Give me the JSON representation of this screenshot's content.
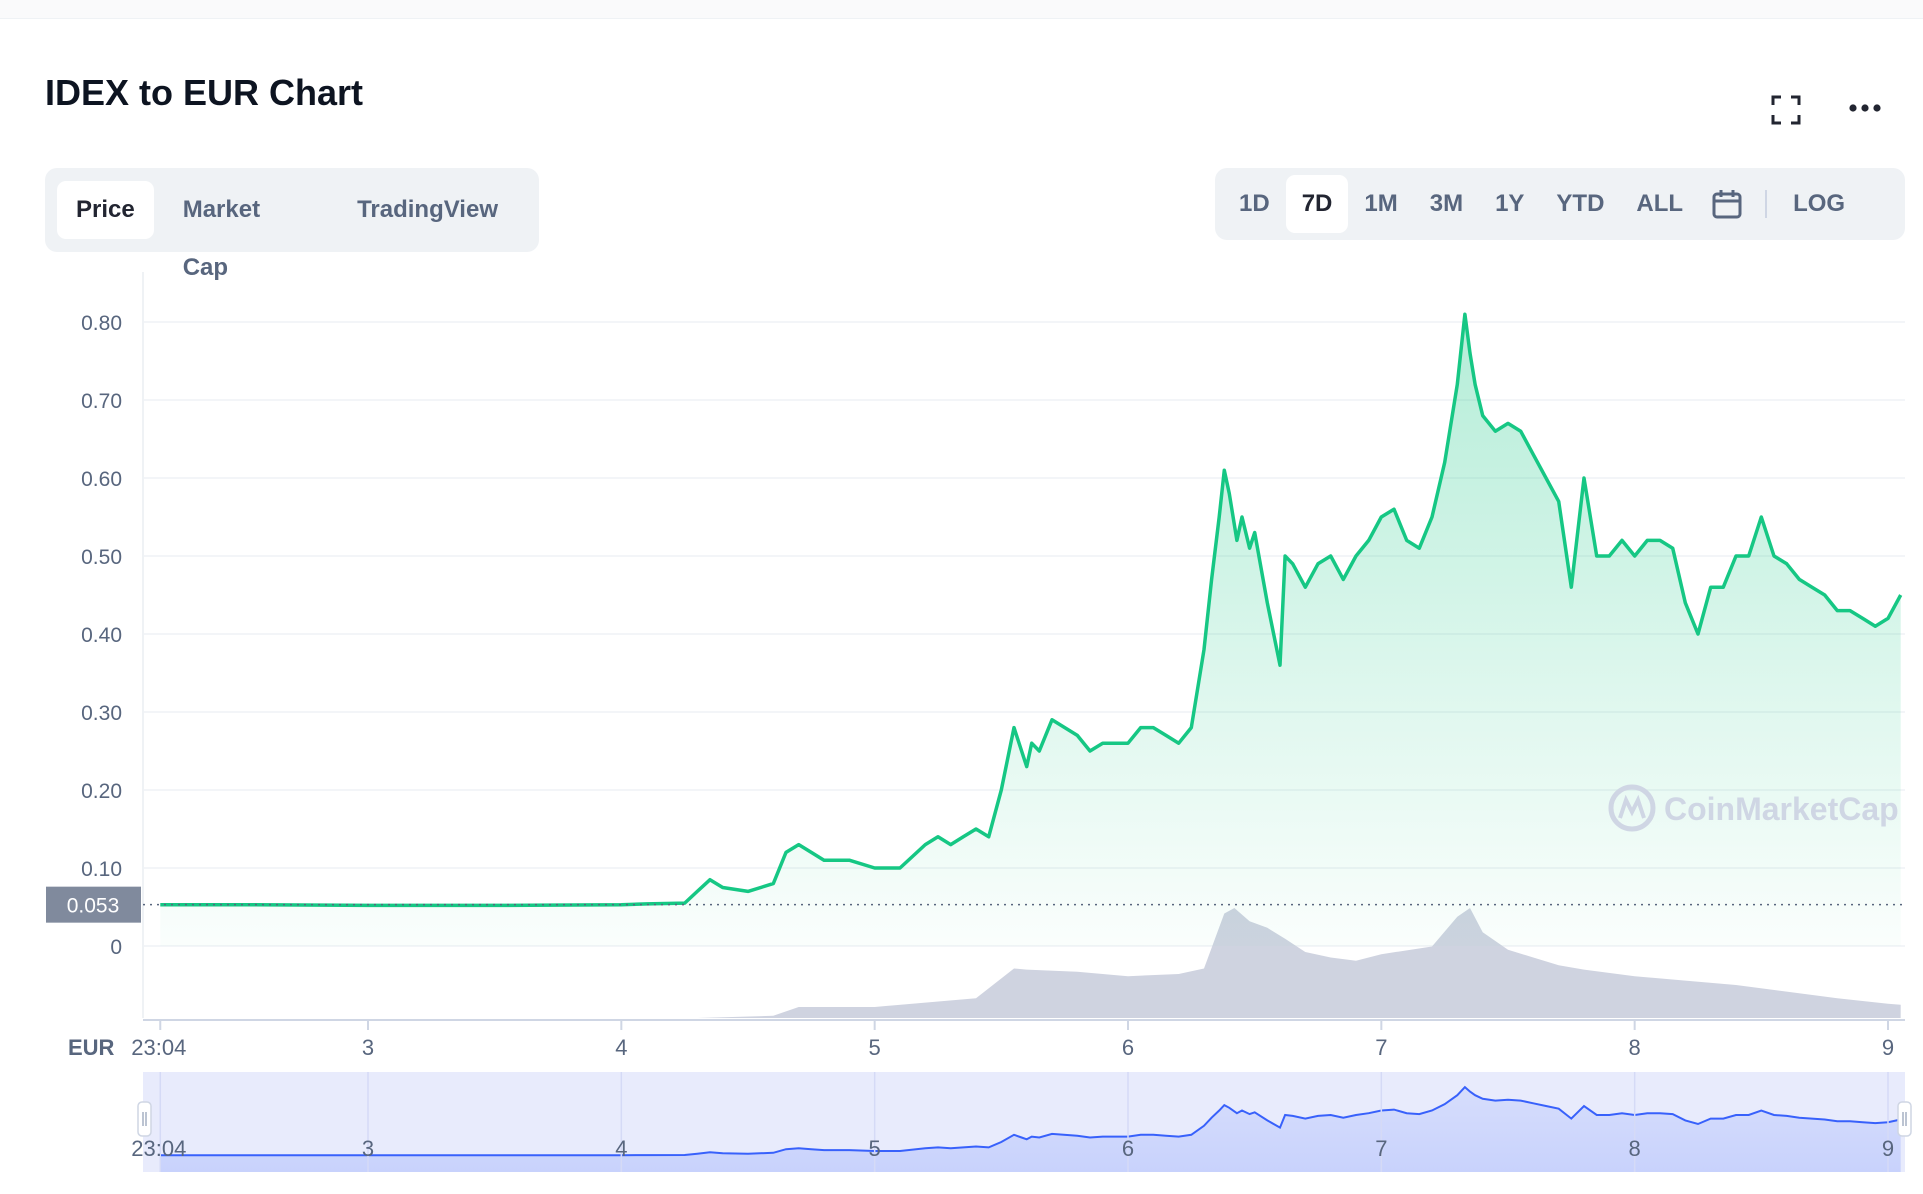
{
  "page": {
    "title": "IDEX to EUR Chart"
  },
  "header_icons": {
    "fullscreen": "fullscreen-icon",
    "more": "more-dots-icon"
  },
  "tabs": [
    {
      "label": "Price",
      "active": true
    },
    {
      "label": "Market Cap",
      "active": false
    },
    {
      "label": "TradingView",
      "active": false
    }
  ],
  "ranges": [
    {
      "label": "1D",
      "active": false
    },
    {
      "label": "7D",
      "active": true
    },
    {
      "label": "1M",
      "active": false
    },
    {
      "label": "3M",
      "active": false
    },
    {
      "label": "1Y",
      "active": false
    },
    {
      "label": "YTD",
      "active": false
    },
    {
      "label": "ALL",
      "active": false
    }
  ],
  "calendar_icon": "calendar-icon",
  "log_label": "LOG",
  "watermark": "CoinMarketCap",
  "colors": {
    "line": "#16c784",
    "fill": "#16c784",
    "volume": "#cfd3e0",
    "navigator_line": "#3861fb",
    "navigator_bg": "#e8ebfc",
    "current_box": "#808a9d"
  },
  "chart_data": {
    "type": "line",
    "title": "IDEX to EUR Chart",
    "currency_label": "EUR",
    "current_price": 0.053,
    "current_price_label": "0.053",
    "ylim": [
      0,
      0.8
    ],
    "y_ticks": [
      {
        "value": 0,
        "label": "0"
      },
      {
        "value": 0.1,
        "label": "0.10"
      },
      {
        "value": 0.2,
        "label": "0.20"
      },
      {
        "value": 0.3,
        "label": "0.30"
      },
      {
        "value": 0.4,
        "label": "0.40"
      },
      {
        "value": 0.5,
        "label": "0.50"
      },
      {
        "value": 0.6,
        "label": "0.60"
      },
      {
        "value": 0.7,
        "label": "0.70"
      },
      {
        "value": 0.8,
        "label": "0.80"
      }
    ],
    "xlim": [
      2.826,
      9.0
    ],
    "x_ticks": [
      {
        "value": 2.18,
        "label": "23:04"
      },
      {
        "value": 3,
        "label": "3"
      },
      {
        "value": 4,
        "label": "4"
      },
      {
        "value": 5,
        "label": "5"
      },
      {
        "value": 6,
        "label": "6"
      },
      {
        "value": 7,
        "label": "7"
      },
      {
        "value": 8,
        "label": "8"
      },
      {
        "value": 9,
        "label": "9"
      }
    ],
    "series": [
      {
        "x": [
          2.18,
          2.5,
          3.0,
          3.5,
          4.0,
          4.1,
          4.25,
          4.3,
          4.35,
          4.4,
          4.5,
          4.6,
          4.65,
          4.7,
          4.75,
          4.8,
          4.9,
          5.0,
          5.1,
          5.2,
          5.25,
          5.3,
          5.35,
          5.4,
          5.45,
          5.5,
          5.55,
          5.58,
          5.6,
          5.62,
          5.65,
          5.7,
          5.8,
          5.85,
          5.9,
          6.0,
          6.05,
          6.1,
          6.15,
          6.2,
          6.25,
          6.3,
          6.33,
          6.36,
          6.38,
          6.4,
          6.43,
          6.45,
          6.48,
          6.5,
          6.55,
          6.6,
          6.62,
          6.65,
          6.7,
          6.75,
          6.8,
          6.85,
          6.9,
          6.95,
          7.0,
          7.05,
          7.1,
          7.15,
          7.2,
          7.25,
          7.3,
          7.33,
          7.35,
          7.37,
          7.4,
          7.45,
          7.5,
          7.55,
          7.6,
          7.65,
          7.7,
          7.75,
          7.8,
          7.85,
          7.9,
          7.95,
          8.0,
          8.05,
          8.1,
          8.15,
          8.2,
          8.25,
          8.3,
          8.35,
          8.4,
          8.45,
          8.5,
          8.55,
          8.6,
          8.65,
          8.7,
          8.75,
          8.8,
          8.85,
          8.9,
          8.95,
          9.0,
          9.05
        ],
        "y": [
          0.053,
          0.053,
          0.052,
          0.052,
          0.053,
          0.054,
          0.055,
          0.07,
          0.085,
          0.075,
          0.07,
          0.08,
          0.12,
          0.13,
          0.12,
          0.11,
          0.11,
          0.1,
          0.1,
          0.13,
          0.14,
          0.13,
          0.14,
          0.15,
          0.14,
          0.2,
          0.28,
          0.25,
          0.23,
          0.26,
          0.25,
          0.29,
          0.27,
          0.25,
          0.26,
          0.26,
          0.28,
          0.28,
          0.27,
          0.26,
          0.28,
          0.38,
          0.47,
          0.55,
          0.61,
          0.58,
          0.52,
          0.55,
          0.51,
          0.53,
          0.44,
          0.36,
          0.5,
          0.49,
          0.46,
          0.49,
          0.5,
          0.47,
          0.5,
          0.52,
          0.55,
          0.56,
          0.52,
          0.51,
          0.55,
          0.62,
          0.72,
          0.81,
          0.76,
          0.72,
          0.68,
          0.66,
          0.67,
          0.66,
          0.63,
          0.6,
          0.57,
          0.46,
          0.6,
          0.5,
          0.5,
          0.52,
          0.5,
          0.52,
          0.52,
          0.51,
          0.44,
          0.4,
          0.46,
          0.46,
          0.5,
          0.5,
          0.55,
          0.5,
          0.49,
          0.47,
          0.46,
          0.45,
          0.43,
          0.43,
          0.42,
          0.41,
          0.42,
          0.45
        ]
      }
    ],
    "volume": {
      "x": [
        2.18,
        4.3,
        4.6,
        4.7,
        5.0,
        5.4,
        5.55,
        5.6,
        5.8,
        6.0,
        6.2,
        6.3,
        6.38,
        6.42,
        6.48,
        6.55,
        6.62,
        6.7,
        6.8,
        6.9,
        7.0,
        7.2,
        7.3,
        7.35,
        7.4,
        7.5,
        7.6,
        7.7,
        7.8,
        8.0,
        8.2,
        8.4,
        8.6,
        8.8,
        9.0,
        9.05
      ],
      "y": [
        0,
        0,
        0.02,
        0.1,
        0.1,
        0.18,
        0.45,
        0.44,
        0.42,
        0.38,
        0.4,
        0.45,
        0.95,
        1.0,
        0.88,
        0.82,
        0.72,
        0.6,
        0.55,
        0.52,
        0.58,
        0.65,
        0.92,
        1.0,
        0.78,
        0.62,
        0.55,
        0.48,
        0.44,
        0.38,
        0.34,
        0.3,
        0.24,
        0.18,
        0.13,
        0.12
      ]
    },
    "navigator": {
      "x_ticks": [
        {
          "value": 2.18,
          "label": "23:04"
        },
        {
          "value": 3,
          "label": "3"
        },
        {
          "value": 4,
          "label": "4"
        },
        {
          "value": 5,
          "label": "5"
        },
        {
          "value": 6,
          "label": "6"
        },
        {
          "value": 7,
          "label": "7"
        },
        {
          "value": 8,
          "label": "8"
        },
        {
          "value": 9,
          "label": "9"
        }
      ]
    }
  }
}
